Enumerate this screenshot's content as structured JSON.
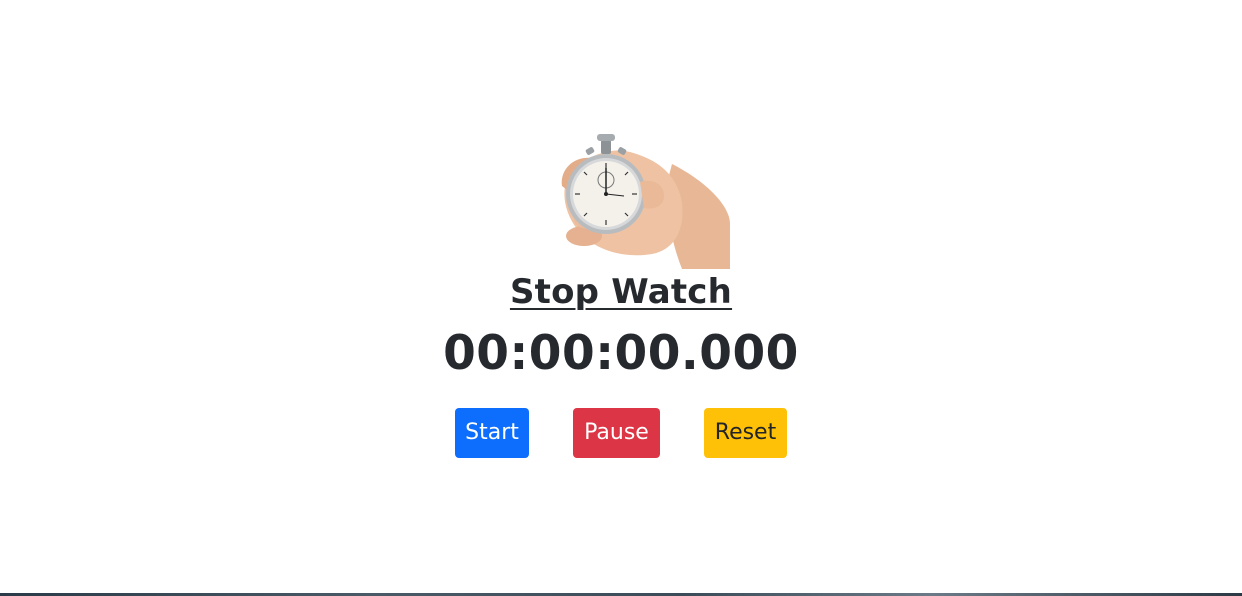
{
  "app": {
    "title": "Stop Watch",
    "timer_display": "00:00:00.000"
  },
  "hero": {
    "icon": "stopwatch-in-hand-icon"
  },
  "buttons": {
    "start_label": "Start",
    "pause_label": "Pause",
    "reset_label": "Reset"
  },
  "colors": {
    "text": "#262a2f",
    "start": "#0d6efd",
    "pause": "#dc3545",
    "reset": "#ffc107",
    "start_text": "#ffffff",
    "pause_text": "#ffffff",
    "reset_text": "#212529"
  }
}
